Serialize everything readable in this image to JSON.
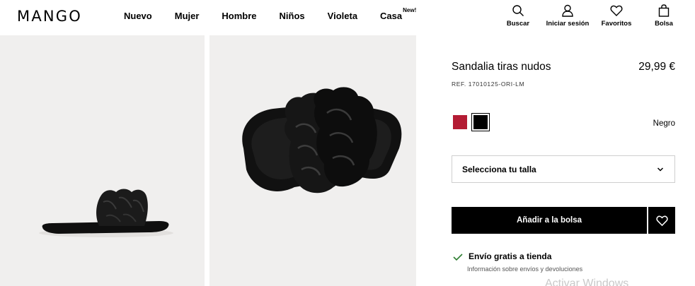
{
  "header": {
    "logo": "MANGO",
    "nav": [
      {
        "label": "Nuevo"
      },
      {
        "label": "Mujer"
      },
      {
        "label": "Hombre"
      },
      {
        "label": "Niños"
      },
      {
        "label": "Violeta"
      },
      {
        "label": "Casa",
        "badge": "New!"
      }
    ],
    "actions": {
      "search": "Buscar",
      "login": "Iniciar sesión",
      "favorites": "Favoritos",
      "bag": "Bolsa"
    }
  },
  "product": {
    "title": "Sandalia tiras nudos",
    "price": "29,99 €",
    "ref": "REF. 17010125-ORI-LM",
    "colors": [
      {
        "name": "red",
        "hex": "#b41c34"
      },
      {
        "name": "Negro",
        "hex": "#000000",
        "selected": true
      }
    ],
    "selected_color": "Negro",
    "size_placeholder": "Selecciona tu talla",
    "add_to_bag": "Añadir a la bolsa",
    "shipping_title": "Envío gratis a tienda",
    "shipping_info": "Información sobre envíos y devoluciones"
  },
  "system": {
    "watermark": "Activar Windows"
  }
}
